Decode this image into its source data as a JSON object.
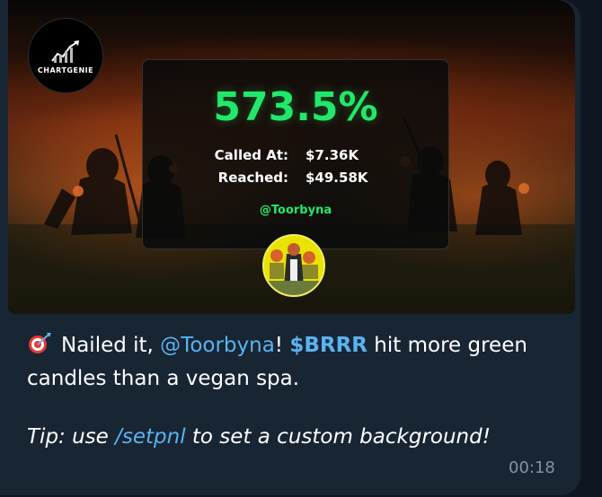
{
  "logo": {
    "text": "CHARTGENIE"
  },
  "card": {
    "percentage": "573.5%",
    "called_label": "Called At:",
    "called_value": "$7.36K",
    "reached_label": "Reached:",
    "reached_value": "$49.58K",
    "handle": "@Toorbyna"
  },
  "message": {
    "emoji": "bullseye-dart-icon",
    "part1": "Nailed it, ",
    "mention": "@Toorbyna",
    "part2": "! ",
    "cashtag": "$BRRR",
    "part3": " hit more green candles than a vegan spa.",
    "tip_part1": "Tip: use ",
    "tip_command": "/setpnl",
    "tip_part2": " to set a custom background!",
    "time": "00:18"
  },
  "colors": {
    "bubble": "#182533",
    "background": "#0e1621",
    "accent_green": "#22e86a",
    "link_blue": "#5ab3f0"
  }
}
